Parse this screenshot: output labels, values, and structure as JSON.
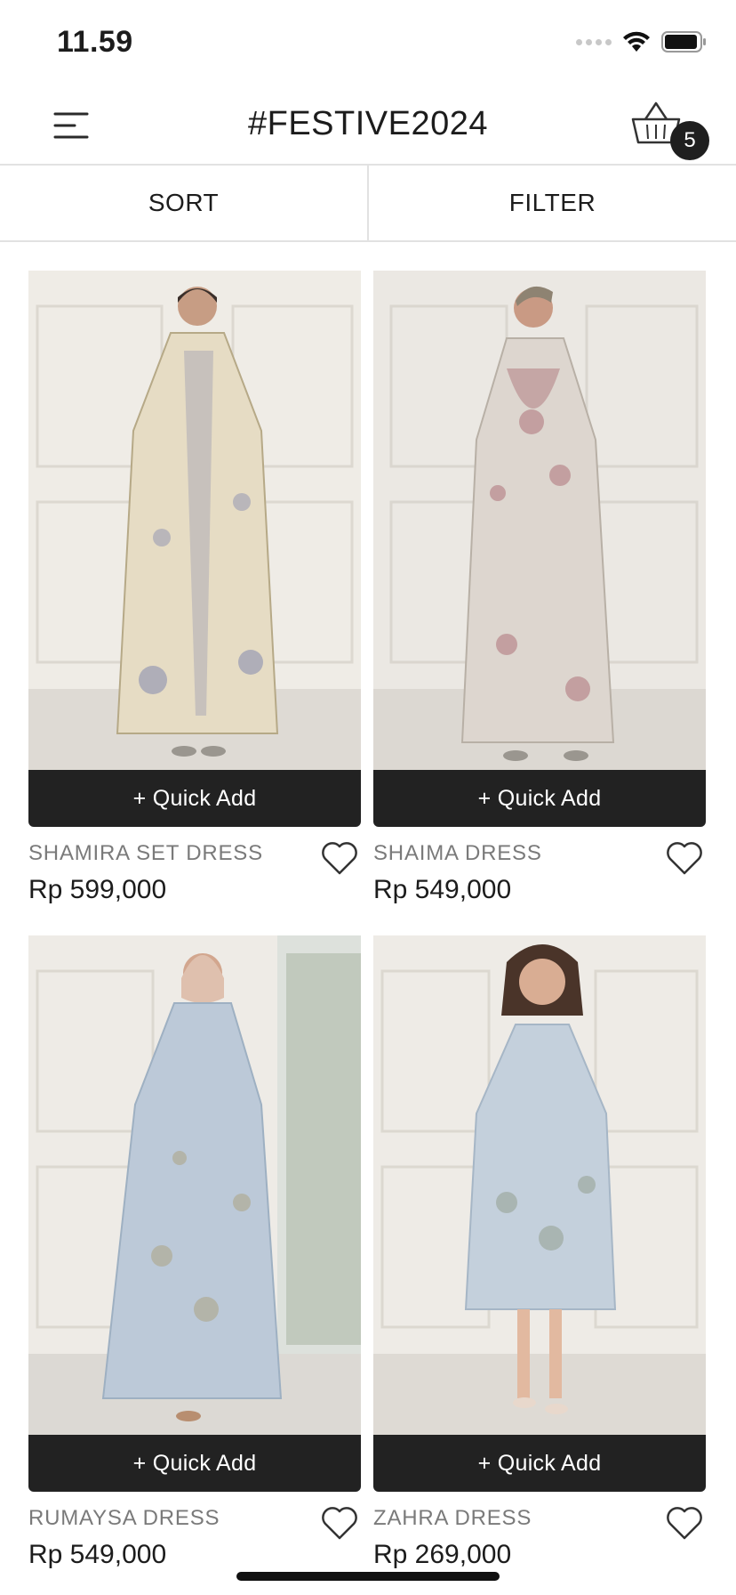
{
  "status": {
    "time": "11.59"
  },
  "header": {
    "title": "#FESTIVE2024",
    "cart_count": "5"
  },
  "toolbar": {
    "sort_label": "SORT",
    "filter_label": "FILTER"
  },
  "products": [
    {
      "name": "SHAMIRA SET DRESS",
      "price": "Rp 599,000",
      "quick_add": "+ Quick Add",
      "dress_color": "#e6dcc4",
      "accent_color": "#8b8fb0"
    },
    {
      "name": "SHAIMA DRESS",
      "price": "Rp 549,000",
      "quick_add": "+ Quick Add",
      "dress_color": "#ddd6cf",
      "accent_color": "#a35e66"
    },
    {
      "name": "RUMAYSA DRESS",
      "price": "Rp 549,000",
      "quick_add": "+ Quick Add",
      "dress_color": "#bcc9d8",
      "accent_color": "#a9a07a"
    },
    {
      "name": "ZAHRA DRESS",
      "price": "Rp 269,000",
      "quick_add": "+ Quick Add",
      "dress_color": "#c4d0dc",
      "accent_color": "#8e9a88"
    }
  ]
}
